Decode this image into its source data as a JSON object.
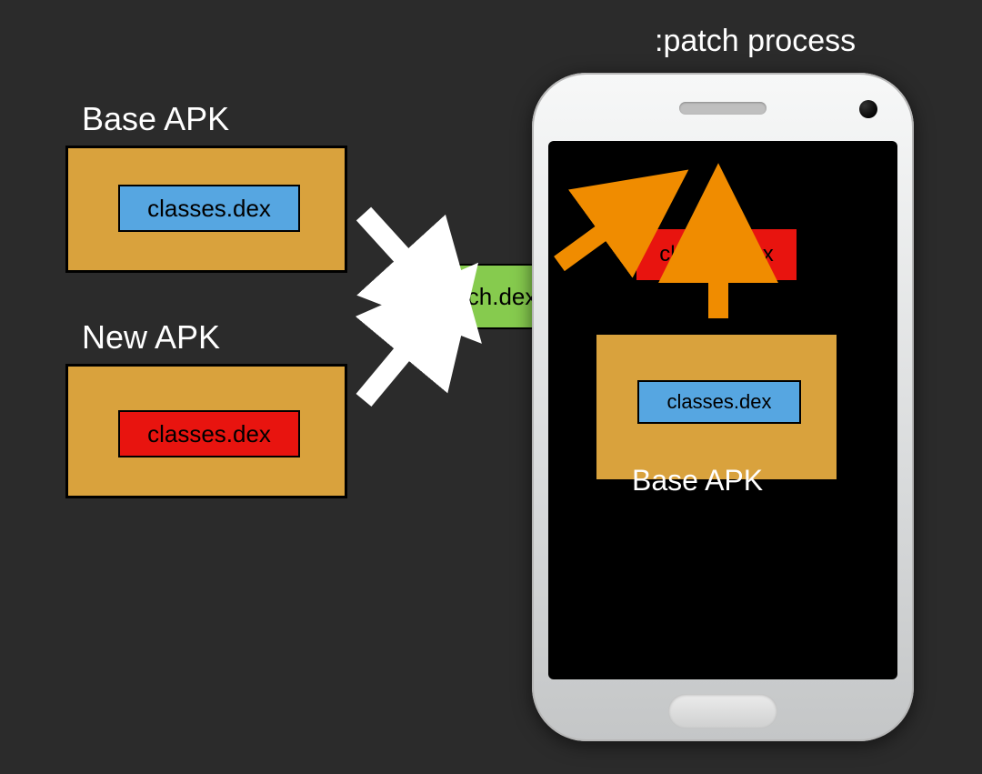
{
  "title_patch_process": ":patch process",
  "left": {
    "base_apk_label": "Base APK",
    "new_apk_label": "New APK",
    "base_dex": "classes.dex",
    "new_dex": "classes.dex"
  },
  "center": {
    "patch_dex": "patch.dex"
  },
  "phone": {
    "patched_dex": "classes.dex",
    "inner_apk_dex": "classes.dex",
    "inner_apk_label": "Base APK"
  },
  "colors": {
    "bg": "#2b2b2b",
    "apk": "#d9a23d",
    "blue": "#56a6e1",
    "red": "#e8140f",
    "green": "#86cb4e",
    "arrow_white": "#ffffff",
    "arrow_orange": "#f08c00"
  }
}
